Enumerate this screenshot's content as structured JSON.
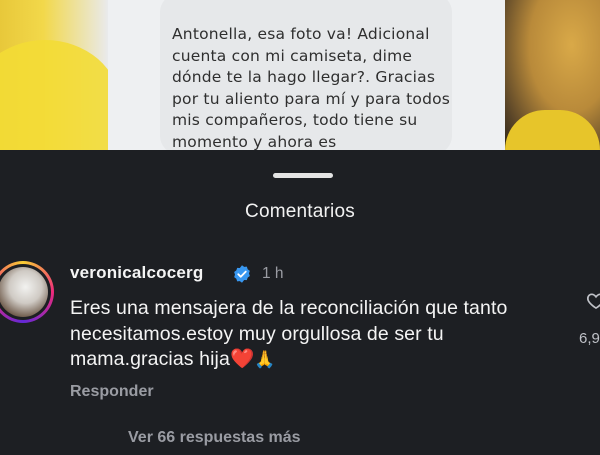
{
  "post": {
    "message": "Antonella, esa foto va! Adicional cuenta con mi camiseta, dime dónde te la hago llegar?. Gracias por tu aliento para mí y para todos mis compañeros, todo tiene su momento y ahora es"
  },
  "sheet": {
    "title": "Comentarios"
  },
  "comment": {
    "username": "veronicalcocerg",
    "verified_icon": "verified-badge-icon",
    "time": "1 h",
    "text": "Eres una mensajera de la reconciliación que tanto necesitamos.estoy muy orgullosa de ser tu mama.gracias hija",
    "emoji_heart": "❤️",
    "emoji_pray": "🙏",
    "reply_label": "Responder",
    "view_replies_label": "Ver 66 respuestas más",
    "like_count": "6,9"
  },
  "colors": {
    "sheet_bg": "#1d1f23",
    "text_primary": "#f4f4f4",
    "text_secondary": "#9a9ca3",
    "verified_blue": "#3897f0"
  }
}
